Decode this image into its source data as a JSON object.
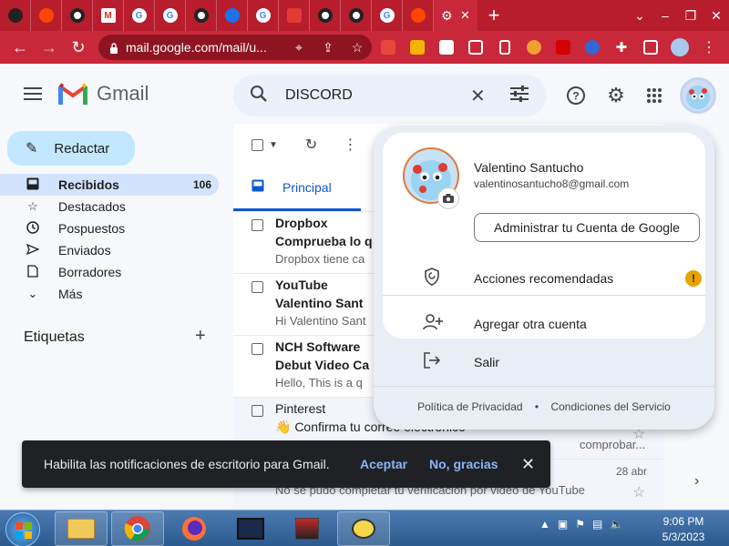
{
  "browser": {
    "tabs": [
      "",
      "",
      "",
      "",
      "",
      "",
      "",
      "",
      "",
      "",
      "",
      "",
      "",
      "",
      ""
    ],
    "active_tab_close": "✕",
    "new_tab": "+",
    "address": "mail.google.com/mail/u...",
    "window_controls": [
      "⌄",
      "–",
      "❐",
      "✕"
    ]
  },
  "gmail": {
    "logo_text": "Gmail",
    "search_value": "DISCORD",
    "compose_label": "Redactar",
    "nav": [
      {
        "label": "Recibidos",
        "count": "106",
        "icon": "inbox-icon"
      },
      {
        "label": "Destacados",
        "count": "",
        "icon": "star-icon"
      },
      {
        "label": "Pospuestos",
        "count": "",
        "icon": "clock-icon"
      },
      {
        "label": "Enviados",
        "count": "",
        "icon": "send-icon"
      },
      {
        "label": "Borradores",
        "count": "",
        "icon": "draft-icon"
      },
      {
        "label": "Más",
        "count": "",
        "icon": "chevron-down-icon"
      }
    ],
    "labels_title": "Etiquetas",
    "tab_principal": "Principal",
    "emails": [
      {
        "sender": "Dropbox",
        "subject": "Comprueba lo q",
        "snippet": "Dropbox tiene ca"
      },
      {
        "sender": "YouTube",
        "subject": "Valentino Sant",
        "snippet": "Hi Valentino Sant"
      },
      {
        "sender": "NCH Software",
        "subject": "Debut Video Ca",
        "snippet": "Hello, This is a q"
      },
      {
        "sender": "Pinterest",
        "subject": "👋 Confirma tu correo electrónico",
        "snippet": "comprobar..."
      },
      {
        "sender": "",
        "subject": "",
        "snippet": "No se pudo completar tu verificación por video de YouTube",
        "date": "28 abr"
      }
    ]
  },
  "account_popup": {
    "name": "Valentino Santucho",
    "email": "valentinosantucho8@gmail.com",
    "manage_label": "Administrar tu Cuenta de Google",
    "recommended": "Acciones recomendadas",
    "add_account": "Agregar otra cuenta",
    "sign_out": "Salir",
    "privacy": "Política de Privacidad",
    "separator": "•",
    "terms": "Condiciones del Servicio"
  },
  "snackbar": {
    "message": "Habilita las notificaciones de escritorio para Gmail.",
    "accept": "Aceptar",
    "decline": "No, gracias"
  },
  "taskbar": {
    "time": "9:06 PM",
    "date": "5/3/2023"
  }
}
